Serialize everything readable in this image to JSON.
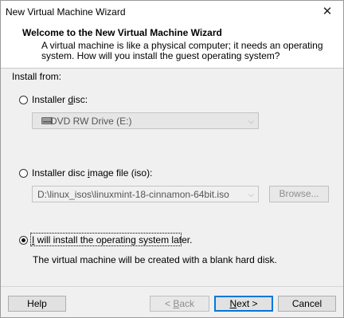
{
  "window": {
    "title": "New Virtual Machine Wizard",
    "close_glyph": "✕"
  },
  "header": {
    "title": "Welcome to the New Virtual Machine Wizard",
    "description": "A virtual machine is like a physical computer; it needs an operating system. How will you install the guest operating system?"
  },
  "install_from": {
    "label": "Install from:",
    "options": [
      {
        "pre": "Installer ",
        "key": "d",
        "post": "isc:",
        "selected": false
      },
      {
        "pre": "Installer disc ",
        "key": "i",
        "post": "mage file (iso):",
        "selected": false
      },
      {
        "pre": "",
        "key": "I",
        "post": " will install the operating system later.",
        "selected": true
      }
    ],
    "disc_drive": {
      "value": "DVD RW Drive (E:)",
      "enabled": false
    },
    "iso_path": {
      "value": "D:\\linux_isos\\linuxmint-18-cinnamon-64bit.iso",
      "enabled": false
    },
    "browse_label": "Browse...",
    "later_note": "The virtual machine will be created with a blank hard disk."
  },
  "buttons": {
    "help": "Help",
    "back_pre": "< ",
    "back_key": "B",
    "back_post": "ack",
    "next_key": "N",
    "next_post": "ext >",
    "cancel": "Cancel"
  }
}
